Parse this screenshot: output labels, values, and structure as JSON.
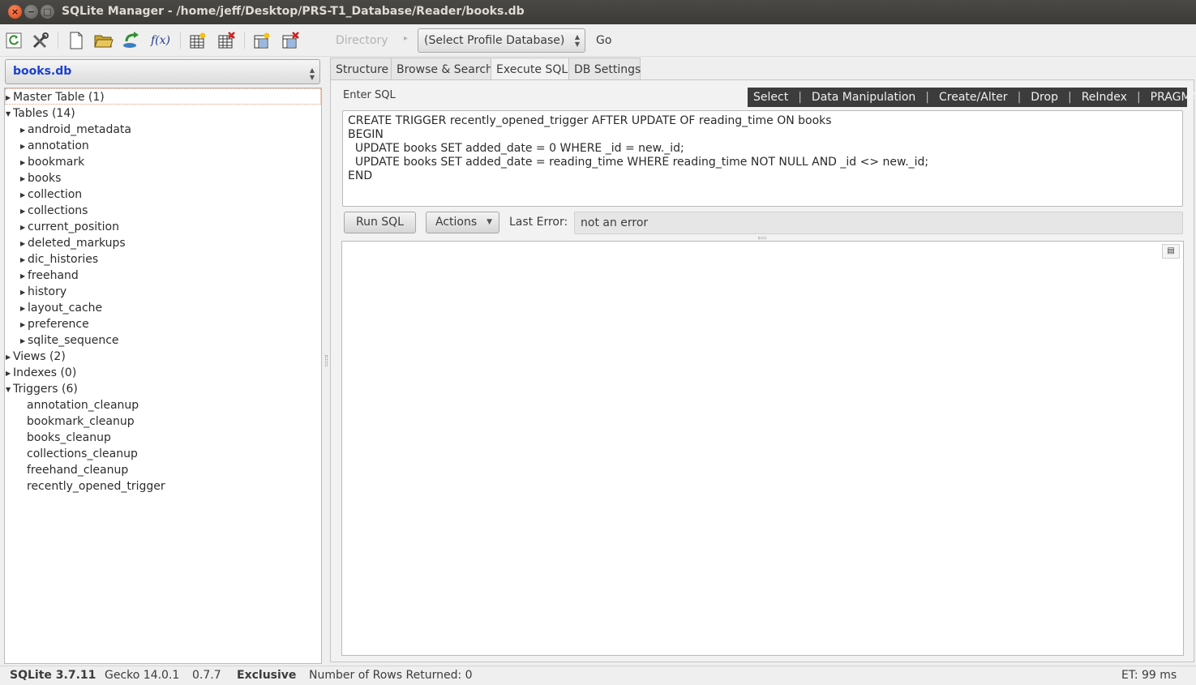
{
  "window": {
    "title": "SQLite Manager - /home/jeff/Desktop/PRS-T1_Database/Reader/books.db",
    "close_glyph": "×",
    "minimize_glyph": "−",
    "maximize_glyph": "□"
  },
  "toolbar": {
    "icons": [
      "refresh-icon",
      "tools-icon",
      "new-file-icon",
      "open-folder-icon",
      "export-icon",
      "function-icon",
      "create-table-icon",
      "drop-table-icon",
      "create-index-icon",
      "drop-index-icon"
    ],
    "function_label": "f(x)",
    "directory_label": "Directory",
    "profile_select": "(Select Profile Database)",
    "go_label": "Go"
  },
  "sidebar": {
    "db_select": "books.db",
    "tree": {
      "master": "Master Table (1)",
      "tables_header": "Tables (14)",
      "tables": [
        "android_metadata",
        "annotation",
        "bookmark",
        "books",
        "collection",
        "collections",
        "current_position",
        "deleted_markups",
        "dic_histories",
        "freehand",
        "history",
        "layout_cache",
        "preference",
        "sqlite_sequence"
      ],
      "views": "Views (2)",
      "indexes": "Indexes (0)",
      "triggers_header": "Triggers (6)",
      "triggers": [
        "annotation_cleanup",
        "bookmark_cleanup",
        "books_cleanup",
        "collections_cleanup",
        "freehand_cleanup",
        "recently_opened_trigger"
      ]
    }
  },
  "tabs": [
    "Structure",
    "Browse & Search",
    "Execute SQL",
    "DB Settings"
  ],
  "active_tab": "Execute SQL",
  "execute": {
    "enter_sql_label": "Enter SQL",
    "sql_menu": [
      "Select",
      "Data Manipulation",
      "Create/Alter",
      "Drop",
      "ReIndex",
      "PRAGMA"
    ],
    "sql_text": "CREATE TRIGGER recently_opened_trigger AFTER UPDATE OF reading_time ON books\nBEGIN\n  UPDATE books SET added_date = 0 WHERE _id = new._id;\n  UPDATE books SET added_date = reading_time WHERE reading_time NOT NULL AND _id <> new._id;\nEND",
    "run_sql_label": "Run SQL",
    "actions_label": "Actions",
    "last_error_label": "Last Error:",
    "last_error_value": "not an error"
  },
  "status": {
    "sqlite_version": "SQLite 3.7.11",
    "gecko": "Gecko 14.0.1",
    "ext_version": "0.7.7",
    "mode": "Exclusive",
    "rows_returned": "Number of Rows Returned: 0",
    "elapsed": "ET: 99 ms"
  }
}
